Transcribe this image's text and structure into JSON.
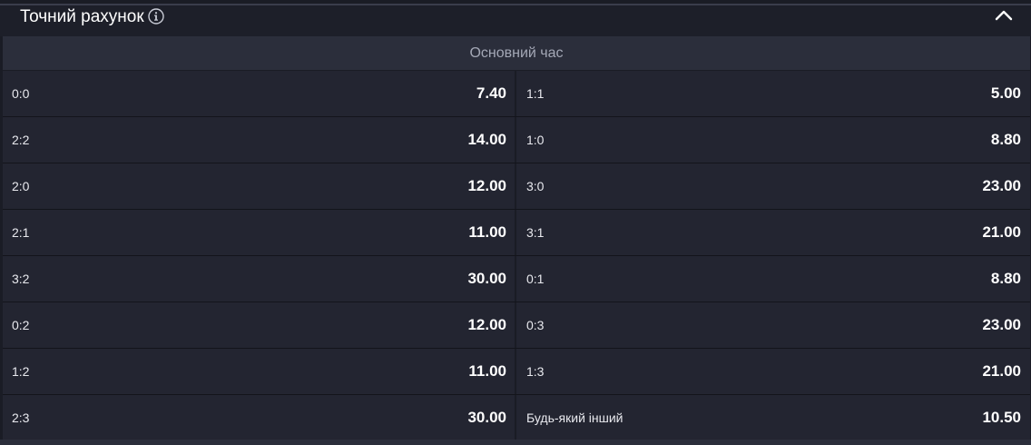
{
  "market": {
    "title": "Точний рахунок",
    "info_icon": "info-icon",
    "collapse_icon": "chevron-up-icon",
    "section": "Основний час"
  },
  "rows": [
    {
      "left": {
        "outcome": "0:0",
        "odds": "7.40"
      },
      "right": {
        "outcome": "1:1",
        "odds": "5.00"
      }
    },
    {
      "left": {
        "outcome": "2:2",
        "odds": "14.00"
      },
      "right": {
        "outcome": "1:0",
        "odds": "8.80"
      }
    },
    {
      "left": {
        "outcome": "2:0",
        "odds": "12.00"
      },
      "right": {
        "outcome": "3:0",
        "odds": "23.00"
      }
    },
    {
      "left": {
        "outcome": "2:1",
        "odds": "11.00"
      },
      "right": {
        "outcome": "3:1",
        "odds": "21.00"
      }
    },
    {
      "left": {
        "outcome": "3:2",
        "odds": "30.00"
      },
      "right": {
        "outcome": "0:1",
        "odds": "8.80"
      }
    },
    {
      "left": {
        "outcome": "0:2",
        "odds": "12.00"
      },
      "right": {
        "outcome": "0:3",
        "odds": "23.00"
      }
    },
    {
      "left": {
        "outcome": "1:2",
        "odds": "11.00"
      },
      "right": {
        "outcome": "1:3",
        "odds": "21.00"
      }
    },
    {
      "left": {
        "outcome": "2:3",
        "odds": "30.00"
      },
      "right": {
        "outcome": "Будь-який інший",
        "odds": "10.50"
      }
    }
  ]
}
